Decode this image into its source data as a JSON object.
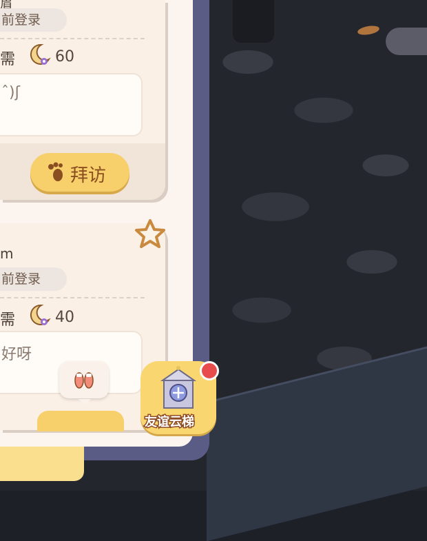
{
  "card1": {
    "name_fragment": "眉",
    "login_status": "前登录",
    "stat_left": "需",
    "moon_value": "60",
    "message": "ˆ)ʃ",
    "visit_label": "拜访"
  },
  "card2": {
    "name_fragment": "m",
    "login_status": "前登录",
    "stat_left": "需",
    "moon_value": "40",
    "message": "好呀"
  },
  "friend_ladder": {
    "label": "友谊云梯",
    "has_notification": true
  },
  "colors": {
    "panel_frame": "#5b5c86",
    "card": "#fbf0e6",
    "accent_button": "#f7cf6b",
    "notification": "#e84b4b"
  }
}
